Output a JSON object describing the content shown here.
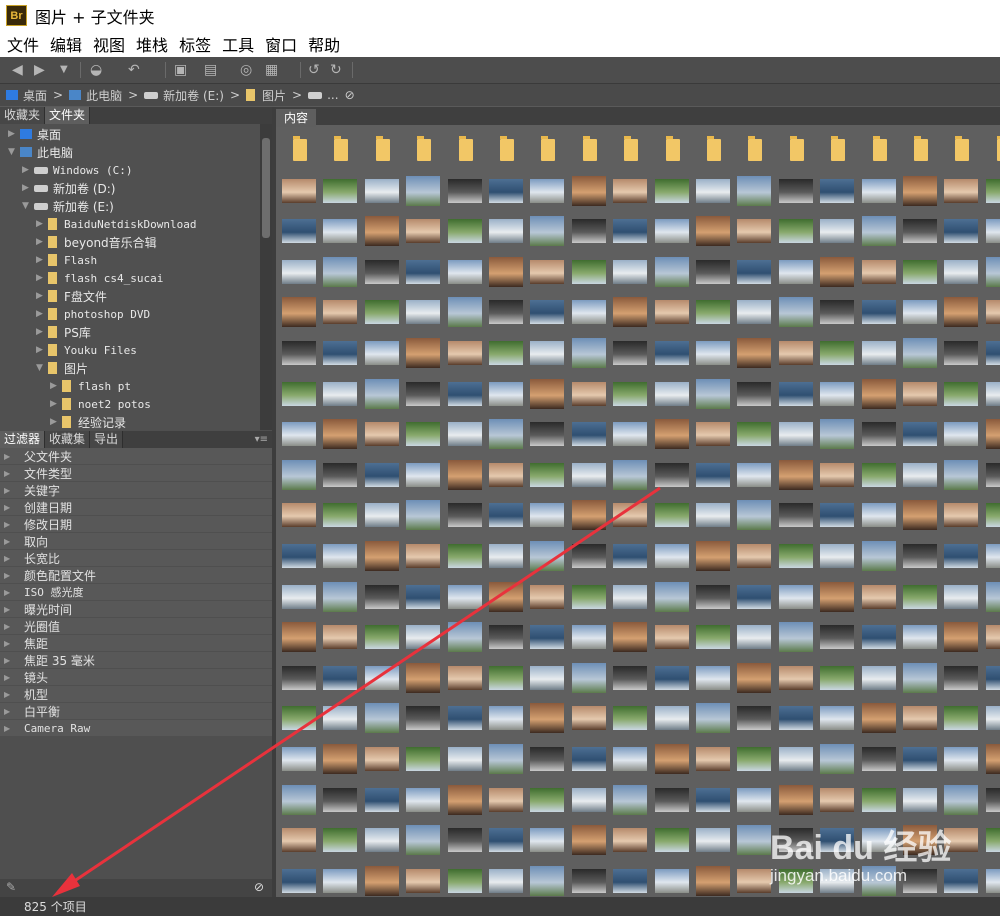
{
  "window": {
    "app_icon": "Br",
    "title": "图片 + 子文件夹"
  },
  "menu": [
    "文件",
    "编辑",
    "视图",
    "堆栈",
    "标签",
    "工具",
    "窗口",
    "帮助"
  ],
  "breadcrumb": [
    {
      "label": "桌面",
      "icon": "desktop-icon"
    },
    {
      "label": "此电脑",
      "icon": "computer-icon"
    },
    {
      "label": "新加卷 (E:)",
      "icon": "drive-icon"
    },
    {
      "label": "图片",
      "icon": "folder-icon"
    },
    {
      "label": "...",
      "icon": "folder-subfolder-icon"
    }
  ],
  "left_top_tabs": [
    "收藏夹",
    "文件夹"
  ],
  "tree": [
    {
      "label": "桌面",
      "level": 0,
      "icon": "desktop-icon",
      "mono": false
    },
    {
      "label": "此电脑",
      "level": 0,
      "icon": "computer-icon",
      "mono": false,
      "expanded": true
    },
    {
      "label": "Windows (C:)",
      "level": 1,
      "icon": "drive-icon",
      "mono": true
    },
    {
      "label": "新加卷 (D:)",
      "level": 1,
      "icon": "drive-icon",
      "mono": false
    },
    {
      "label": "新加卷 (E:)",
      "level": 1,
      "icon": "drive-icon",
      "mono": false,
      "expanded": true
    },
    {
      "label": "BaiduNetdiskDownload",
      "level": 2,
      "icon": "folder-icon",
      "mono": true
    },
    {
      "label": "beyond音乐合辑",
      "level": 2,
      "icon": "folder-icon",
      "mono": false
    },
    {
      "label": "Flash",
      "level": 2,
      "icon": "folder-icon",
      "mono": true
    },
    {
      "label": "flash cs4_sucai",
      "level": 2,
      "icon": "folder-icon",
      "mono": true
    },
    {
      "label": "F盘文件",
      "level": 2,
      "icon": "folder-icon",
      "mono": false
    },
    {
      "label": "photoshop DVD",
      "level": 2,
      "icon": "folder-icon",
      "mono": true
    },
    {
      "label": "PS库",
      "level": 2,
      "icon": "folder-icon",
      "mono": false
    },
    {
      "label": "Youku Files",
      "level": 2,
      "icon": "folder-icon",
      "mono": true
    },
    {
      "label": "图片",
      "level": 2,
      "icon": "folder-icon",
      "mono": false,
      "expanded": true
    },
    {
      "label": "flash pt",
      "level": 3,
      "icon": "folder-icon",
      "mono": true
    },
    {
      "label": "noet2 potos",
      "level": 3,
      "icon": "folder-icon",
      "mono": true
    },
    {
      "label": "经验记录",
      "level": 3,
      "icon": "folder-icon",
      "mono": false
    }
  ],
  "left_bottom_tabs": [
    "过滤器",
    "收藏集",
    "导出"
  ],
  "filters": [
    "父文件夹",
    "文件类型",
    "关键字",
    "创建日期",
    "修改日期",
    "取向",
    "长宽比",
    "颜色配置文件",
    "ISO 感光度",
    "曝光时间",
    "光圈值",
    "焦距",
    "焦距 35 毫米",
    "镜头",
    "机型",
    "白平衡",
    "Camera Raw"
  ],
  "content_tab": "内容",
  "status": "825 个项目",
  "watermark": {
    "text": "Bai du 经验",
    "url": "jingyan.baidu.com"
  },
  "colors": {
    "panel": "#4f4f4f",
    "content_bg": "#5f5f5f",
    "annotation_arrow": "#e8323c",
    "folder": "#f2c766"
  }
}
